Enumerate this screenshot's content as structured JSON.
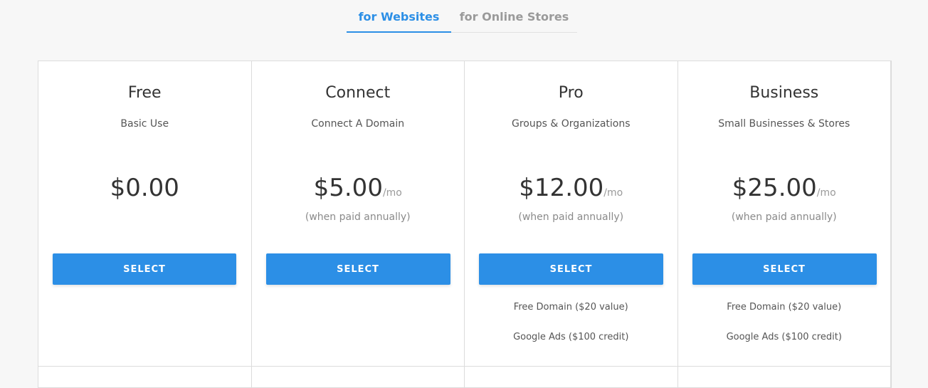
{
  "tabs": [
    {
      "label": "for Websites",
      "active": true
    },
    {
      "label": "for Online Stores",
      "active": false
    }
  ],
  "colors": {
    "accent": "#2c8fe6",
    "background": "#f7f7f7",
    "card": "#ffffff"
  },
  "plans": [
    {
      "name": "Free",
      "description": "Basic Use",
      "price": "$0.00",
      "period": "",
      "note": "",
      "button": "SELECT",
      "features": []
    },
    {
      "name": "Connect",
      "description": "Connect A Domain",
      "price": "$5.00",
      "period": "/mo",
      "note": "(when paid annually)",
      "button": "SELECT",
      "features": []
    },
    {
      "name": "Pro",
      "description": "Groups & Organizations",
      "price": "$12.00",
      "period": "/mo",
      "note": "(when paid annually)",
      "button": "SELECT",
      "features": [
        "Free Domain ($20 value)",
        "Google Ads ($100 credit)"
      ]
    },
    {
      "name": "Business",
      "description": "Small Businesses & Stores",
      "price": "$25.00",
      "period": "/mo",
      "note": "(when paid annually)",
      "button": "SELECT",
      "features": [
        "Free Domain ($20 value)",
        "Google Ads ($100 credit)"
      ]
    }
  ]
}
